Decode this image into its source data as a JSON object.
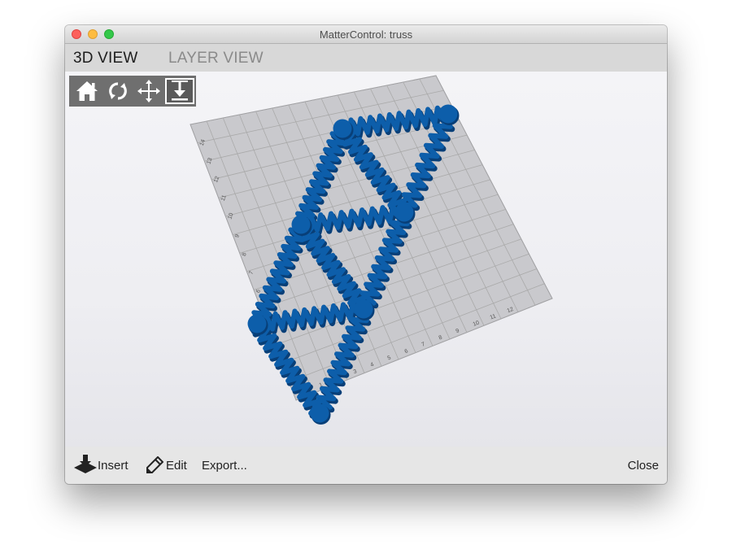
{
  "window": {
    "title": "MatterControl: truss"
  },
  "tabs": {
    "view3d": "3D VIEW",
    "layer": "LAYER VIEW"
  },
  "toolbar": {
    "tools": [
      {
        "name": "home",
        "icon": "home-icon"
      },
      {
        "name": "rotate",
        "icon": "rotate-icon"
      },
      {
        "name": "move",
        "icon": "move-arrows-icon"
      },
      {
        "name": "zoom",
        "icon": "zoom-icon",
        "active": true
      }
    ]
  },
  "bed": {
    "axis_labels_x": [
      "0",
      "1",
      "2",
      "3",
      "4",
      "5",
      "6",
      "7",
      "8",
      "9",
      "10",
      "11",
      "12"
    ],
    "axis_labels_y": [
      "1",
      "2",
      "3",
      "4",
      "5",
      "6",
      "7",
      "8",
      "9",
      "10",
      "11",
      "12",
      "13",
      "14"
    ],
    "grid_color": "#a9a9a9",
    "bed_color": "#c9c9cd"
  },
  "model": {
    "color": "#0d5eaa",
    "shadow_color": "#083f78"
  },
  "bottom": {
    "insert": "Insert",
    "edit": "Edit",
    "export": "Export...",
    "close": "Close"
  }
}
